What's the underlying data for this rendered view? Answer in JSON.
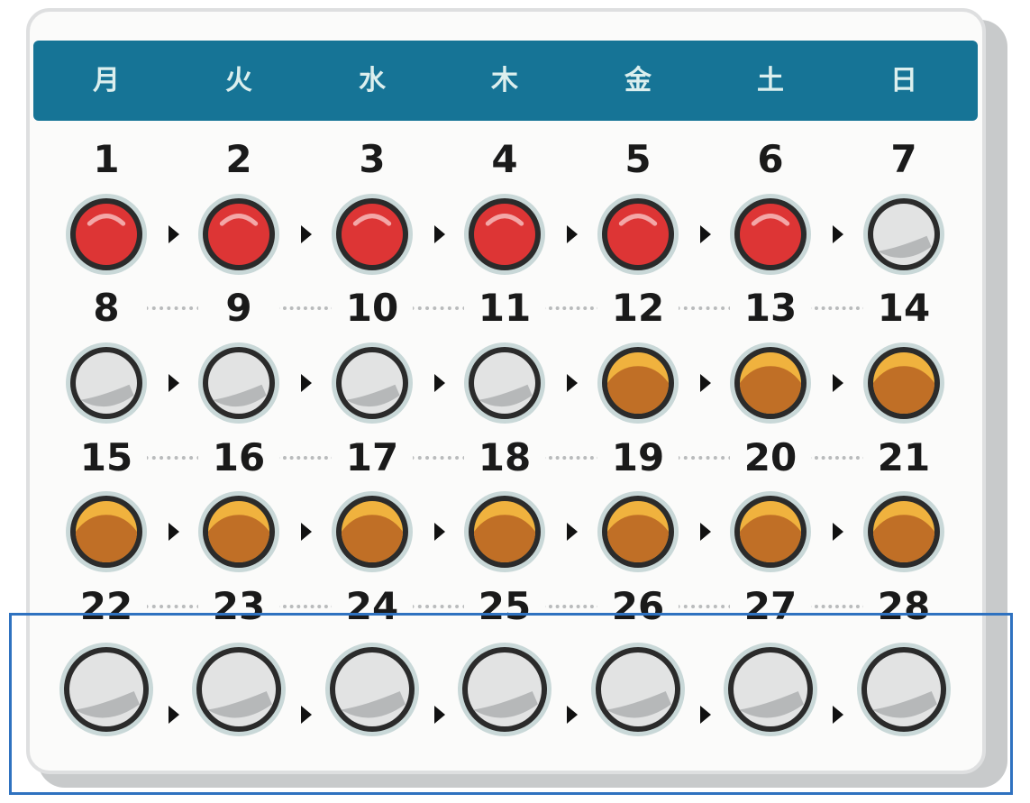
{
  "weekdays": [
    "月",
    "火",
    "水",
    "木",
    "金",
    "土",
    "日"
  ],
  "weeks": [
    {
      "days": [
        1,
        2,
        3,
        4,
        5,
        6,
        7
      ],
      "states": [
        "red",
        "red",
        "red",
        "red",
        "red",
        "red",
        "empty"
      ]
    },
    {
      "days": [
        8,
        9,
        10,
        11,
        12,
        13,
        14
      ],
      "states": [
        "empty",
        "empty",
        "empty",
        "empty",
        "orange",
        "orange",
        "orange"
      ]
    },
    {
      "days": [
        15,
        16,
        17,
        18,
        19,
        20,
        21
      ],
      "states": [
        "orange",
        "orange",
        "orange",
        "orange",
        "orange",
        "orange",
        "orange"
      ]
    },
    {
      "days": [
        22,
        23,
        24,
        25,
        26,
        27,
        28
      ],
      "states": [
        "empty",
        "empty",
        "empty",
        "empty",
        "empty",
        "empty",
        "empty"
      ]
    }
  ],
  "colors": {
    "header": "#167496",
    "red": "#dd3535",
    "orange_top": "#f0b23e",
    "orange_bottom": "#c06f26",
    "empty": "#e2e3e3",
    "selection": "#2f72c0"
  },
  "selected_week_index": 3
}
